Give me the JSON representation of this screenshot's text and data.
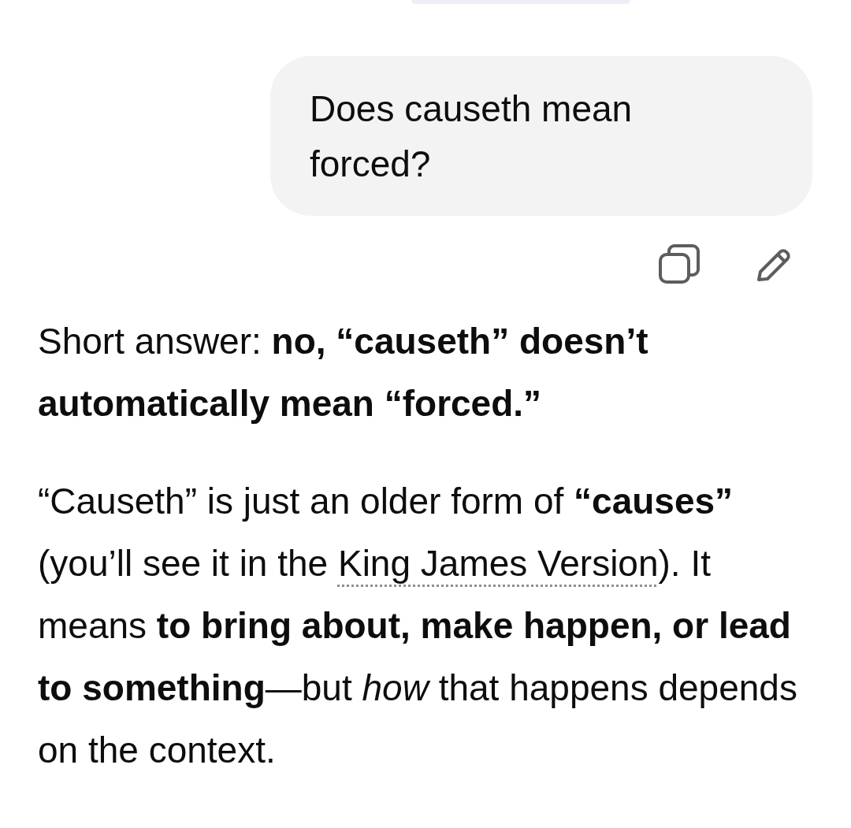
{
  "user_message": {
    "text": "Does causeth mean forced?"
  },
  "answer": {
    "paragraphs": [
      {
        "parts": [
          {
            "kind": "text",
            "text": "Short answer: **no, “causeth” doesn’t automatically mean “forced.”**"
          }
        ]
      },
      {
        "parts": [
          {
            "kind": "text",
            "text": "“Causeth” is just an older form of **“causes”** (you’ll see it in the "
          },
          {
            "kind": "link",
            "text": "King James Version"
          },
          {
            "kind": "text",
            "text": "). It means **to bring about, make happen, or lead to something**—but *how* that happens depends on the context."
          }
        ]
      }
    ]
  }
}
